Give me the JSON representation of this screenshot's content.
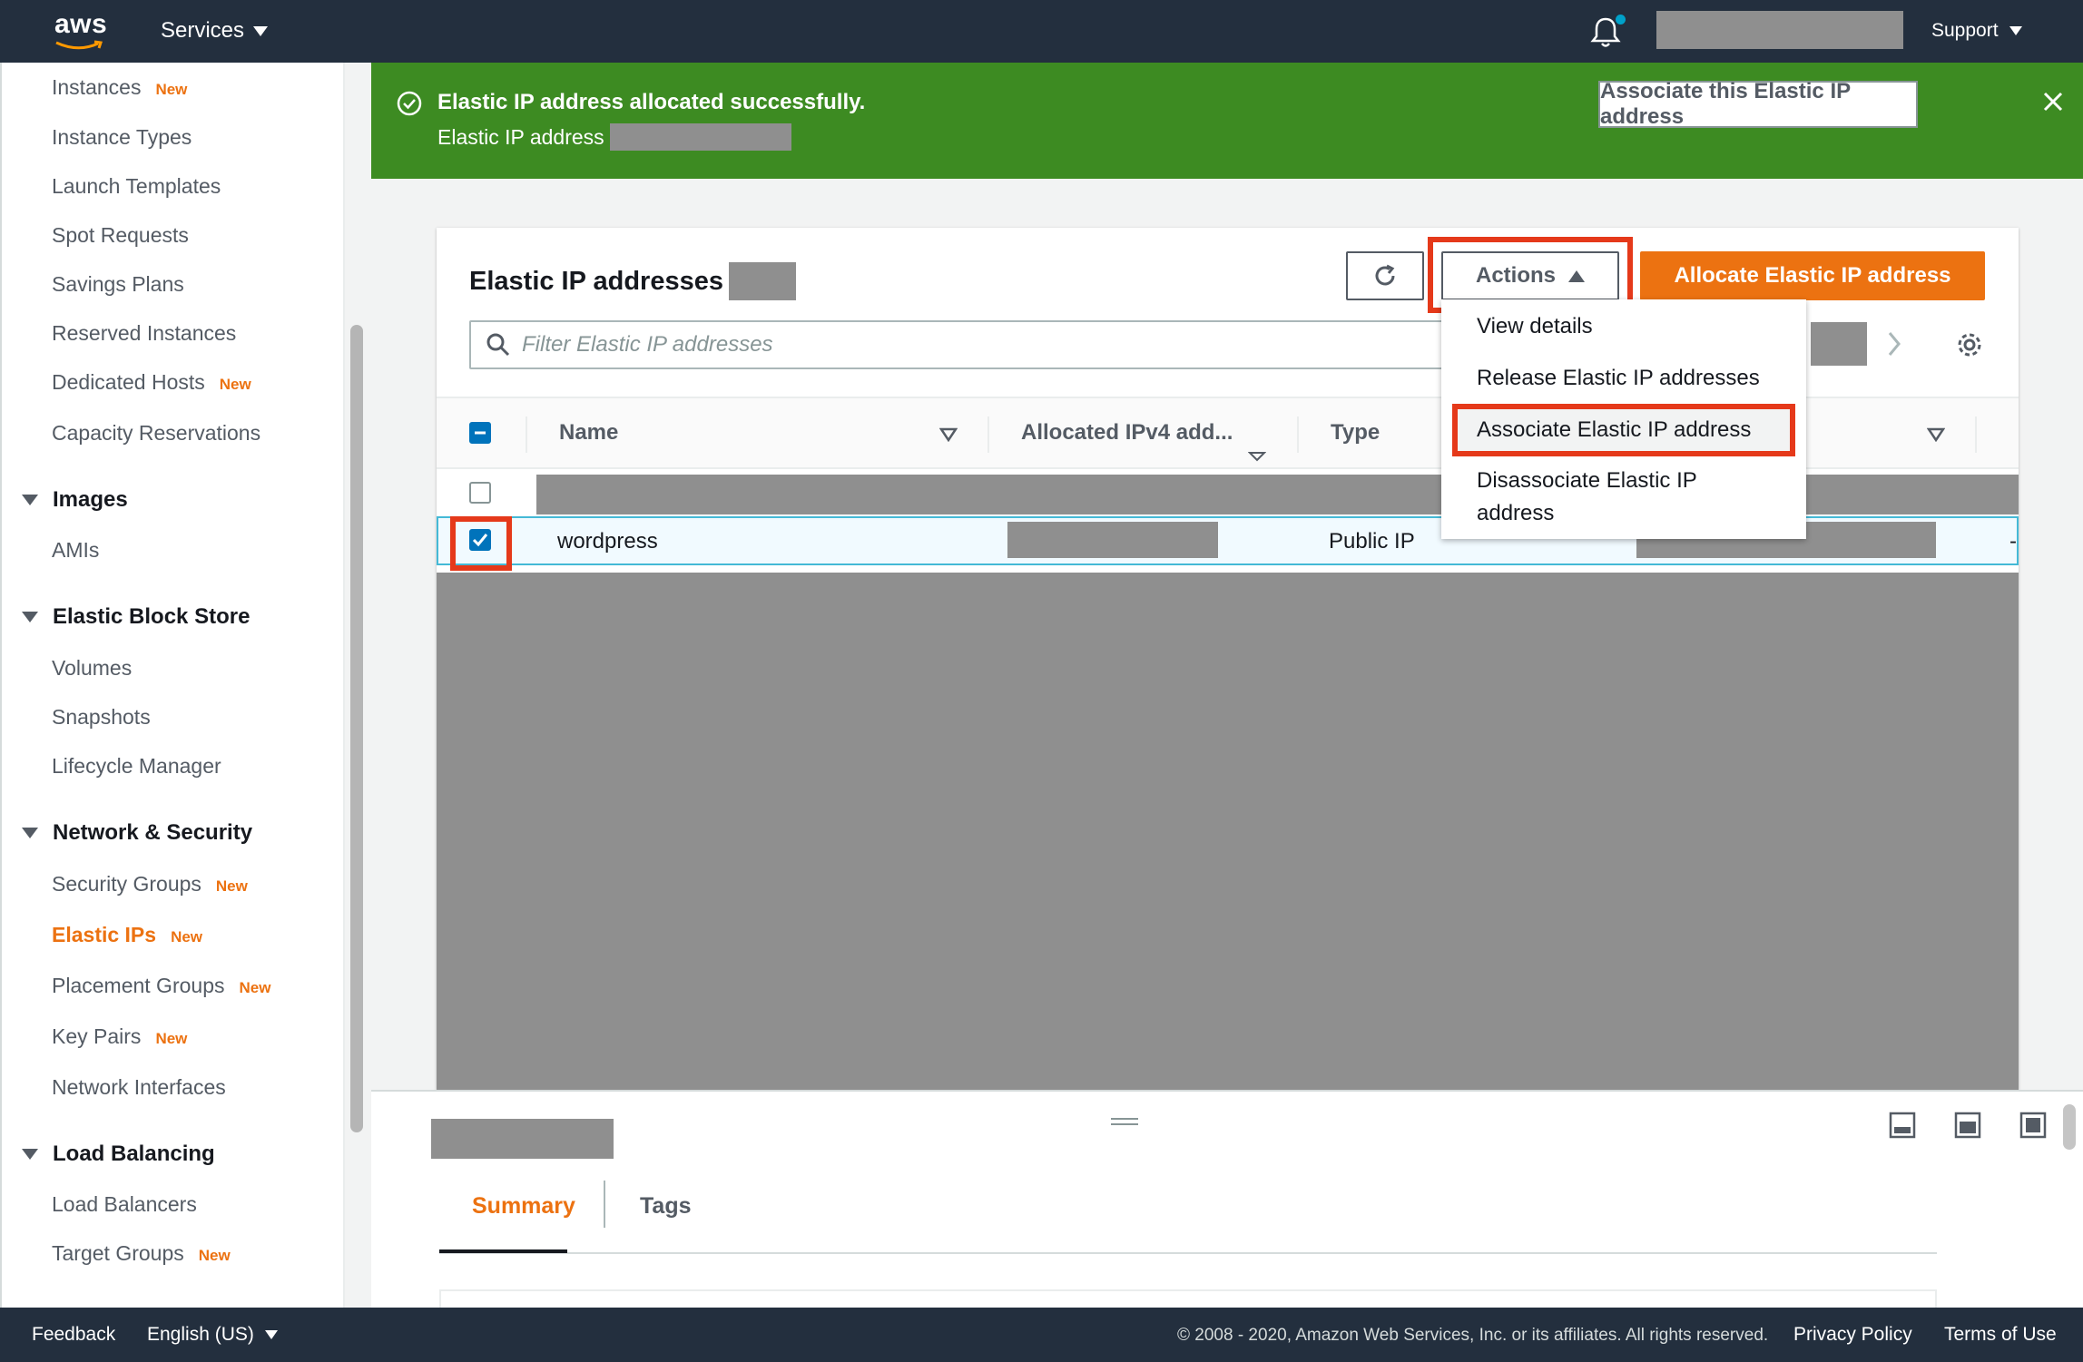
{
  "topnav": {
    "logo": "aws",
    "services_label": "Services",
    "support_label": "Support"
  },
  "sidebar": {
    "new_badge": "New",
    "items": [
      {
        "label": "Instances",
        "new": true
      },
      {
        "label": "Instance Types",
        "new": false
      },
      {
        "label": "Launch Templates",
        "new": false
      },
      {
        "label": "Spot Requests",
        "new": false
      },
      {
        "label": "Savings Plans",
        "new": false
      },
      {
        "label": "Reserved Instances",
        "new": false
      },
      {
        "label": "Dedicated Hosts",
        "new": true
      },
      {
        "label": "Capacity Reservations",
        "new": false
      }
    ],
    "sections": {
      "images": {
        "title": "Images",
        "items": [
          "AMIs"
        ]
      },
      "ebs": {
        "title": "Elastic Block Store",
        "items": [
          "Volumes",
          "Snapshots",
          "Lifecycle Manager"
        ]
      },
      "network": {
        "title": "Network & Security",
        "items": [
          "Security Groups",
          "Elastic IPs",
          "Placement Groups",
          "Key Pairs",
          "Network Interfaces"
        ]
      },
      "lb": {
        "title": "Load Balancing",
        "items": [
          "Load Balancers",
          "Target Groups"
        ]
      }
    },
    "active_item": "Elastic IPs"
  },
  "flash": {
    "title": "Elastic IP address allocated successfully.",
    "subtitle": "Elastic IP address",
    "button": "Associate this Elastic IP address",
    "color": "#3d8b22"
  },
  "card": {
    "title": "Elastic IP addresses",
    "actions_label": "Actions",
    "allocate_label": "Allocate Elastic IP address",
    "filter_placeholder": "Filter Elastic IP addresses",
    "columns": [
      "Name",
      "Allocated IPv4 add...",
      "Type"
    ],
    "rows": [
      {
        "name": "wordpress",
        "type": "Public IP",
        "selected": true,
        "trailing": "-"
      }
    ]
  },
  "actions_menu": {
    "items": [
      "View details",
      "Release Elastic IP addresses",
      "Associate Elastic IP address",
      "Disassociate Elastic IP",
      "address"
    ],
    "highlighted": "Associate Elastic IP address"
  },
  "split_panel": {
    "tabs": [
      "Summary",
      "Tags"
    ],
    "active_tab": "Summary"
  },
  "footer": {
    "feedback": "Feedback",
    "language": "English (US)",
    "copyright": "© 2008 - 2020, Amazon Web Services, Inc. or its affiliates. All rights reserved.",
    "privacy": "Privacy Policy",
    "terms": "Terms of Use"
  },
  "colors": {
    "accent": "#ec7211",
    "nav_bg": "#232f3e",
    "highlight": "#e5391a",
    "selected": "#0073bb"
  }
}
